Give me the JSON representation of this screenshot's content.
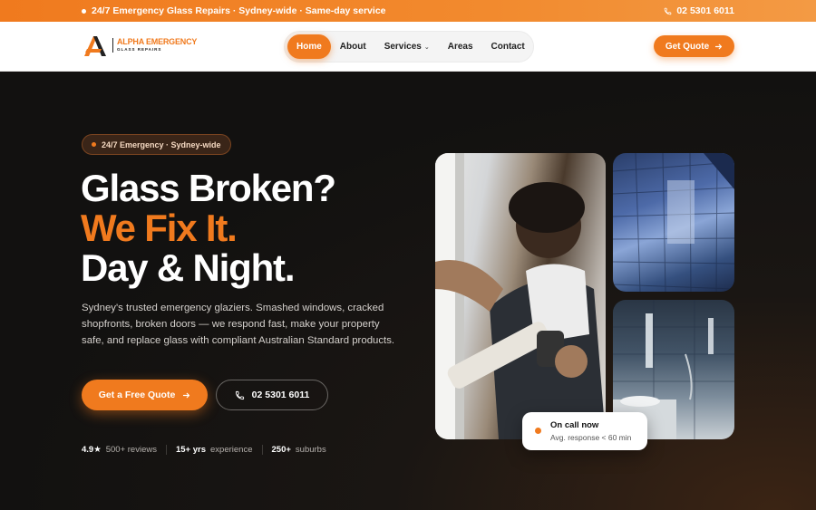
{
  "topbar": {
    "announcement": "24/7 Emergency Glass Repairs · Sydney-wide · Same-day service",
    "phone": "02 5301 6011"
  },
  "logo": {
    "line1": "ALPHA EMERGENCY",
    "line2": "GLASS REPAIRS"
  },
  "nav": {
    "items": [
      {
        "label": "Home"
      },
      {
        "label": "About"
      },
      {
        "label": "Services"
      },
      {
        "label": "Areas"
      },
      {
        "label": "Contact"
      }
    ],
    "active": "Home"
  },
  "header": {
    "cta_label": "Get Quote"
  },
  "hero": {
    "badge": "24/7 Emergency · Sydney-wide",
    "title_line1": "Glass Broken?",
    "title_line2": "We Fix It.",
    "title_line3": "Day & Night.",
    "description": "Sydney's trusted emergency glaziers. Smashed windows, cracked shopfronts, broken doors — we respond fast, make your property safe, and replace glass with compliant Australian Standard products.",
    "primary_cta": "Get a Free Quote",
    "secondary_cta": "02 5301 6011",
    "stats": [
      {
        "value": "4.9★",
        "label": "500+ reviews"
      },
      {
        "value": "15+ yrs",
        "label": "experience"
      },
      {
        "value": "250+",
        "label": "suburbs"
      }
    ]
  },
  "oncall": {
    "title": "On call now",
    "subtitle": "Avg. response < 60 min"
  },
  "colors": {
    "accent": "#f07a1e",
    "dark_bg": "#141210"
  }
}
